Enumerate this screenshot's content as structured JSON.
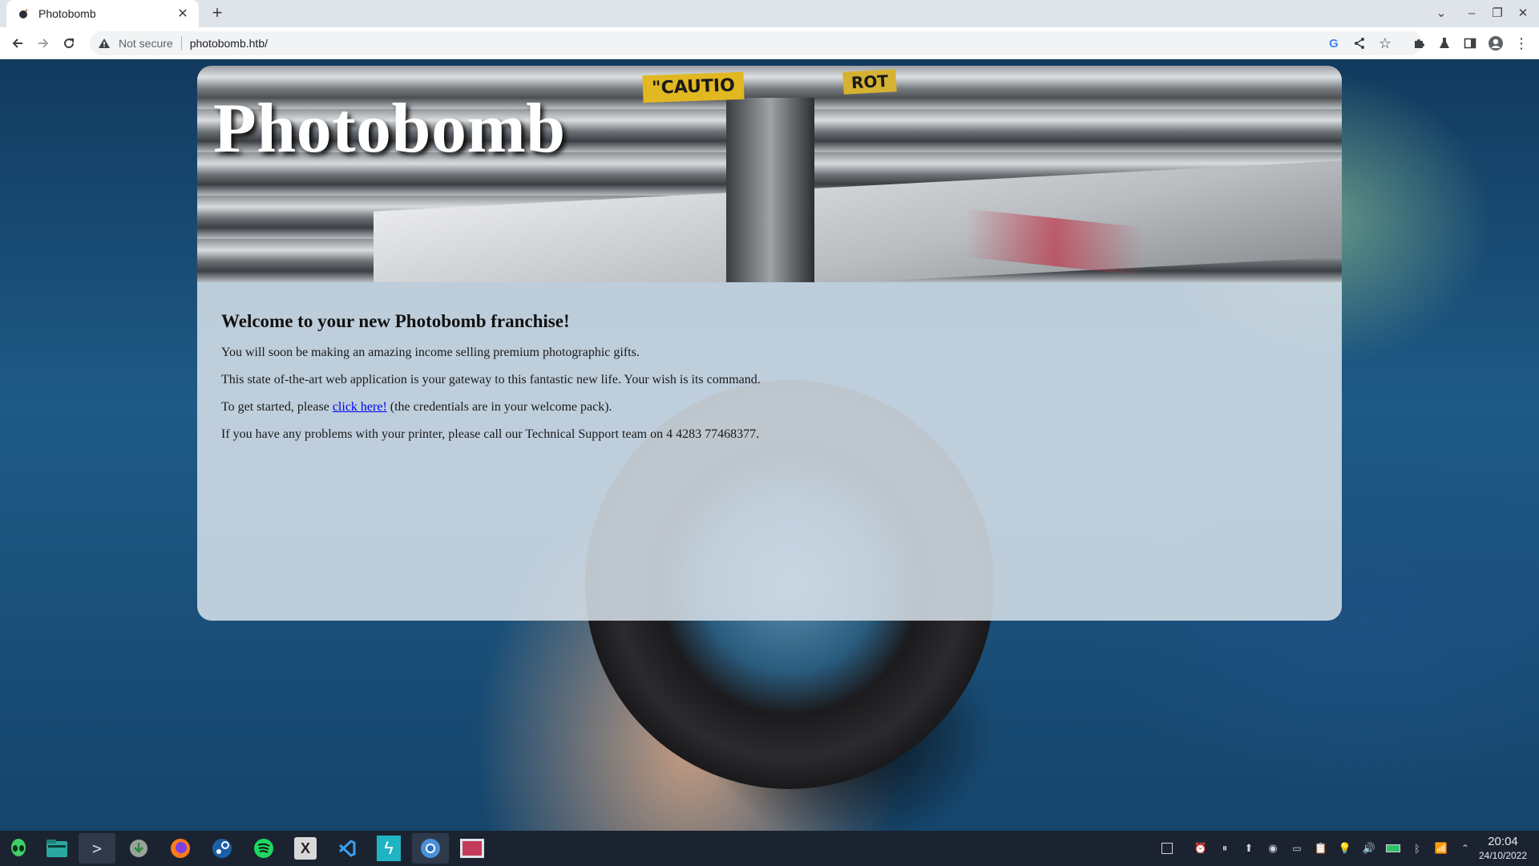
{
  "browser": {
    "tab_title": "Photobomb",
    "security_label": "Not secure",
    "url": "photobomb.htb/"
  },
  "page": {
    "site_title": "Photobomb",
    "banner_sign_1": "\"CAUTIO",
    "banner_sign_2": "ROT",
    "heading": "Welcome to your new Photobomb franchise!",
    "para1": "You will soon be making an amazing income selling premium photographic gifts.",
    "para2": "This state of-the-art web application is your gateway to this fantastic new life. Your wish is its command.",
    "para3_before": "To get started, please ",
    "para3_link": "click here!",
    "para3_after": " (the credentials are in your welcome pack).",
    "para4": "If you have any problems with your printer, please call our Technical Support team on 4 4283 77468377."
  },
  "taskbar": {
    "apps": [
      "alien-icon",
      "files-icon",
      "terminal-icon",
      "download-icon",
      "firefox-icon",
      "steam-icon",
      "spotify-icon",
      "xapp-icon",
      "vscode-icon",
      "burp-icon",
      "chrome-icon",
      "screenshot-icon"
    ],
    "time": "20:04",
    "date": "24/10/2022"
  },
  "colors": {
    "link": "#0000ee",
    "tabstrip": "#dfe3ea",
    "taskbar": "#1b2330"
  }
}
